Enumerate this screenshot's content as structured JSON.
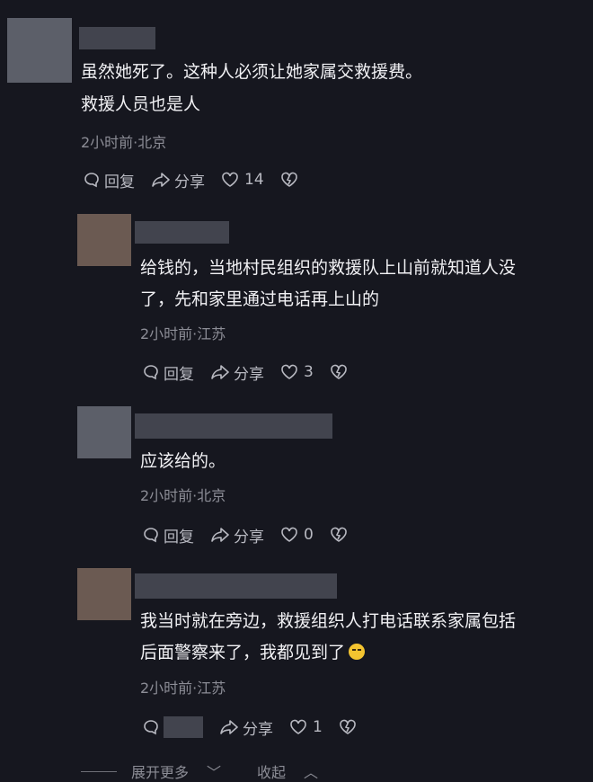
{
  "comments": [
    {
      "text_lines": [
        "虽然她死了。这种人必须让她家属交救援费。",
        "救援人员也是人"
      ],
      "meta": "2小时前·北京",
      "reply_label": "回复",
      "share_label": "分享",
      "likes": "14"
    },
    {
      "text_lines": [
        "给钱的，当地村民组织的救援队上山前就知道人没",
        "了，先和家里通过电话再上山的"
      ],
      "meta": "2小时前·江苏",
      "reply_label": "回复",
      "share_label": "分享",
      "likes": "3"
    },
    {
      "text_lines": [
        "应该给的。"
      ],
      "meta": "2小时前·北京",
      "reply_label": "回复",
      "share_label": "分享",
      "likes": "0"
    },
    {
      "text_lines": [
        "我当时就在旁边，救援组织人打电话联系家属包括",
        "后面警察来了，我都见到了"
      ],
      "meta": "2小时前·江苏",
      "share_label": "分享",
      "likes": "1"
    }
  ],
  "footer": {
    "expand_label": "展开更多",
    "collapse_label": "收起"
  },
  "icons": [
    "reply-icon",
    "share-icon",
    "like-icon",
    "dislike-icon",
    "chevron-down-icon",
    "chevron-up-icon"
  ]
}
